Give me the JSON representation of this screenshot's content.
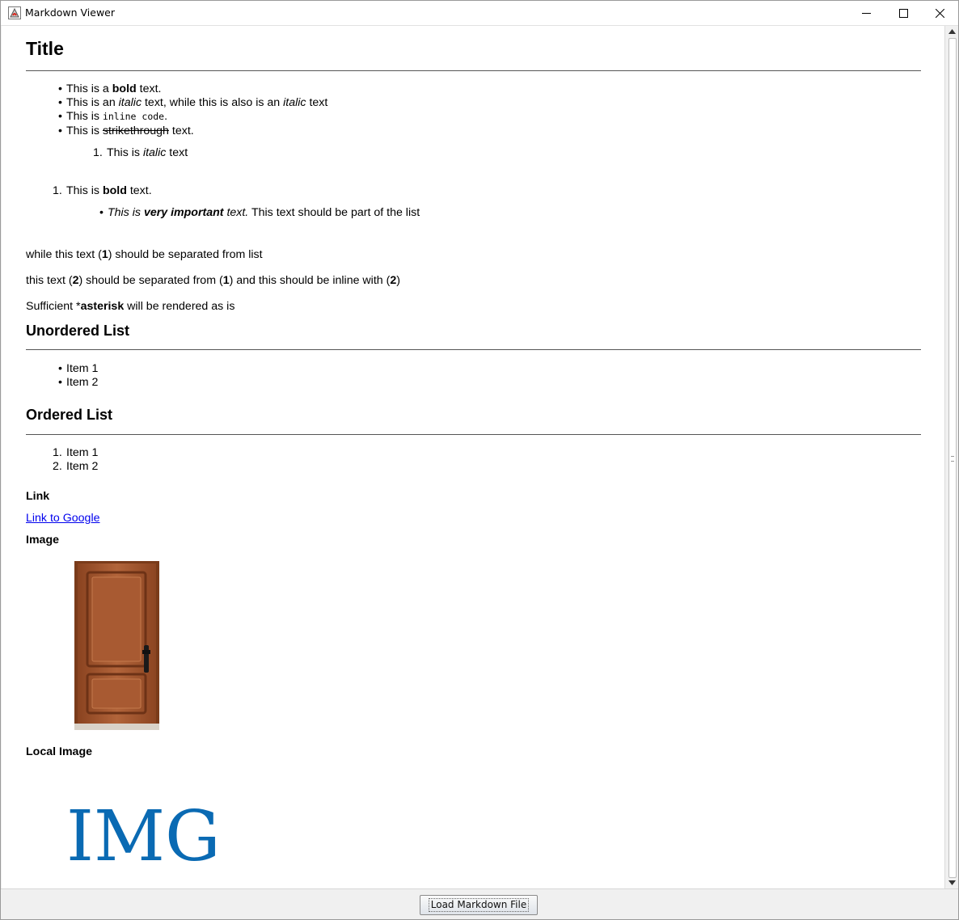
{
  "window": {
    "title": "Markdown Viewer",
    "icons": {
      "app": "java-app-icon",
      "minimize": "minimize-icon",
      "maximize": "maximize-icon",
      "close": "close-icon"
    }
  },
  "document": {
    "title": "Title",
    "bullets": {
      "b1": {
        "pre": "This is a ",
        "bold": "bold",
        "post": " text."
      },
      "b2": {
        "pre": "This is an ",
        "italic1": "italic",
        "mid": " text, while this is also is an ",
        "italic2": "italic",
        "post": " text"
      },
      "b3": {
        "pre": "This is ",
        "code": "inline code",
        "post": "."
      },
      "b4": {
        "pre": "This is ",
        "strike": "strikethrough",
        "post": " text."
      }
    },
    "nested_ordered": {
      "num": "1.",
      "pre": "This is ",
      "italic": "italic",
      "post": " text"
    },
    "ordered_item": {
      "num": "1.",
      "pre": "This is ",
      "bold": "bold",
      "post": " text."
    },
    "nested_bullet": {
      "italic_pre": "This is ",
      "bold_italic": "very important",
      "italic_post": " text.",
      "post": " This text should be part of the list"
    },
    "para1": {
      "pre": "while this text (",
      "bold": "1",
      "post": ") should be separated from list"
    },
    "para2": {
      "pre": "this text (",
      "bold1": "2",
      "mid": ") should be separated from (",
      "bold2": "1",
      "mid2": ") and this should be inline with (",
      "bold3": "2",
      "post": ")"
    },
    "para3": {
      "pre": "Sufficient *",
      "bold": "asterisk",
      "post": " will be rendered as is"
    },
    "unordered_heading": "Unordered List",
    "unordered_items": [
      "Item 1",
      "Item 2"
    ],
    "ordered_heading": "Ordered List",
    "ordered_items": [
      {
        "num": "1.",
        "label": "Item 1"
      },
      {
        "num": "2.",
        "label": "Item 2"
      }
    ],
    "link_heading": "Link",
    "link_text": "Link to Google",
    "image_heading": "Image",
    "local_image_heading": "Local Image",
    "logo_text": "IMG"
  },
  "colors": {
    "link": "#0000ee",
    "logo": "#0a6ab3",
    "door": "#9a4f25"
  },
  "footer": {
    "load_button": "Load Markdown File"
  }
}
